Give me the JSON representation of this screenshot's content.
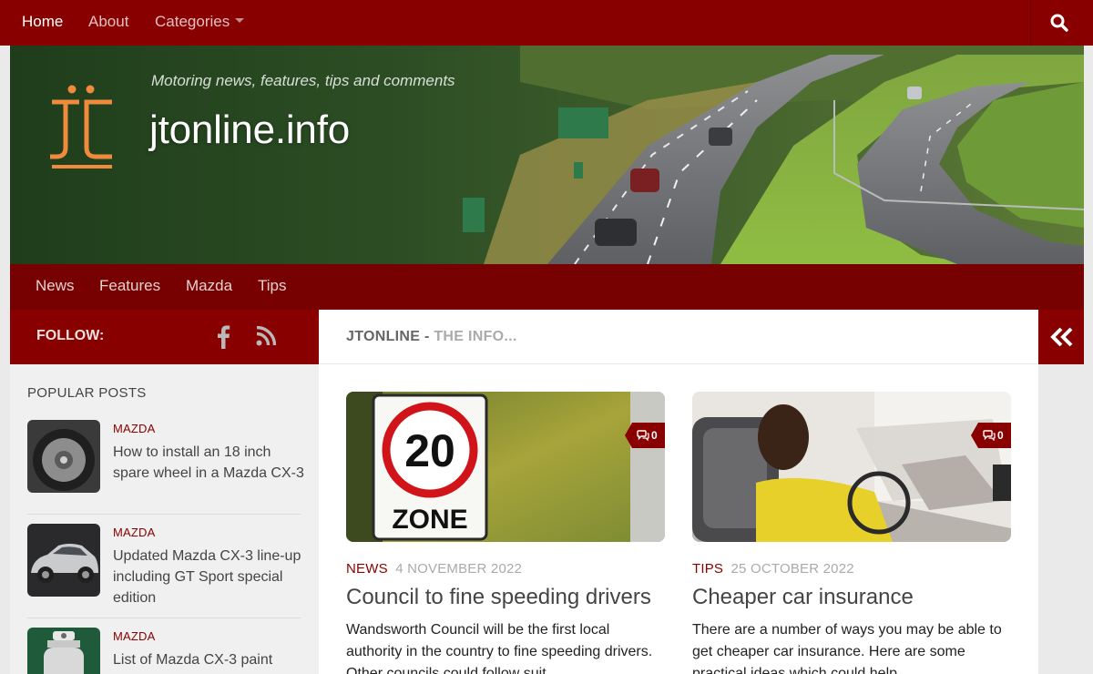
{
  "topnav": {
    "items": [
      {
        "label": "Home"
      },
      {
        "label": "About"
      },
      {
        "label": "Categories"
      }
    ]
  },
  "header": {
    "tagline": "Motoring news, features, tips and comments",
    "site_title": "jtonline.info"
  },
  "subnav": {
    "items": [
      {
        "label": "News"
      },
      {
        "label": "Features"
      },
      {
        "label": "Mazda"
      },
      {
        "label": "Tips"
      }
    ]
  },
  "sidebar": {
    "follow_label": "FOLLOW:",
    "popular_title": "POPULAR POSTS",
    "posts": [
      {
        "category": "MAZDA",
        "title": "How to install an 18 inch spare wheel in a Mazda CX-3"
      },
      {
        "category": "MAZDA",
        "title": "Updated Mazda CX-3 line-up including GT Sport special edition"
      },
      {
        "category": "MAZDA",
        "title": "List of Mazda CX-3 paint"
      }
    ]
  },
  "main": {
    "title": "JTONLINE",
    "title_sep": " - ",
    "subtitle": "THE INFO...",
    "articles": [
      {
        "comments": "0",
        "category": "NEWS",
        "date": "4 NOVEMBER 2022",
        "title": "Council to fine speeding drivers",
        "excerpt": "Wandsworth Council will be the first local authority in the country to fine speeding drivers. Other councils could follow suit.",
        "sign_number": "20",
        "sign_word": "ZONE"
      },
      {
        "comments": "0",
        "category": "TIPS",
        "date": "25 OCTOBER 2022",
        "title": "Cheaper car insurance",
        "excerpt": "There are a number of ways you may be able to get cheaper car insurance. Here are some practical ideas which could help."
      }
    ]
  },
  "colors": {
    "primary": "#880000",
    "subnav": "#770000",
    "logo_orange": "#f08a3c"
  },
  "icons": {
    "search": "search-icon",
    "facebook": "facebook-icon",
    "rss": "rss-icon",
    "collapse": "double-chevron-left-icon",
    "comment": "comment-icon"
  }
}
